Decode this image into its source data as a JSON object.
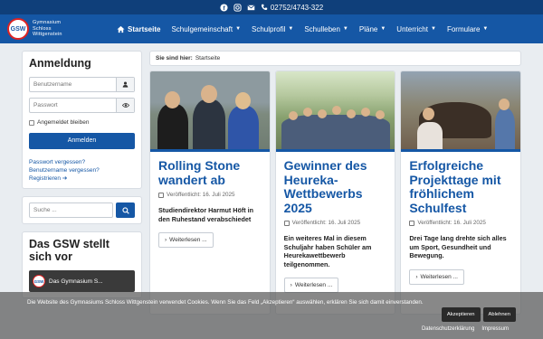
{
  "topbar": {
    "phone": "02752/4743-322",
    "icons": [
      "facebook-icon",
      "instagram-icon",
      "mail-icon",
      "phone-icon"
    ]
  },
  "logo": {
    "badge": "GSW",
    "line1": "Gymnasium",
    "line2": "Schloss",
    "line3": "Wittgenstein"
  },
  "nav": {
    "items": [
      {
        "label": "Startseite",
        "home": true
      },
      {
        "label": "Schulgemeinschaft"
      },
      {
        "label": "Schulprofil"
      },
      {
        "label": "Schulleben"
      },
      {
        "label": "Pläne"
      },
      {
        "label": "Unterricht"
      },
      {
        "label": "Formulare"
      }
    ]
  },
  "login": {
    "title": "Anmeldung",
    "username_placeholder": "Benutzername",
    "password_placeholder": "Passwort",
    "remember_label": "Angemeldet bleiben",
    "submit_label": "Anmelden",
    "forgot_password": "Passwort vergessen?",
    "forgot_username": "Benutzername vergessen?",
    "register": "Registrieren"
  },
  "search": {
    "placeholder": "Suche ..."
  },
  "about": {
    "title": "Das GSW stellt sich vor",
    "video_title": "Das Gymnasium S..."
  },
  "breadcrumb": {
    "label": "Sie sind hier:",
    "current": "Startseite"
  },
  "articles": [
    {
      "title": "Rolling Stone wandert ab",
      "published": "Veröffentlicht: 16. Juli 2025",
      "summary": "Studiendirektor Harmut Höft in den Ruhestand verabschiedet",
      "more": "Weiterlesen ..."
    },
    {
      "title": "Gewinner des Heureka-Wettbewerbs 2025",
      "published": "Veröffentlicht: 16. Juli 2025",
      "summary": "Ein weiteres Mal in diesem Schuljahr haben Schüler am Heurekawettbewerb teilgenommen.",
      "more": "Weiterlesen ..."
    },
    {
      "title": "Erfolgreiche Projekttage mit fröhlichem Schulfest",
      "published": "Veröffentlicht: 16. Juli 2025",
      "summary": "Drei Tage lang drehte sich alles um Sport, Gesundheit und Bewegung.",
      "more": "Weiterlesen ..."
    }
  ],
  "cookie": {
    "text": "Die Website des Gymnasiums Schloss Wittgenstein verwendet Cookies. Wenn Sie das Feld „Akzeptieren“ auswählen, erklären Sie sich damit einverstanden.",
    "accept": "Akzeptieren",
    "decline": "Ablehnen",
    "privacy": "Datenschutzerklärung",
    "imprint": "Impressum"
  },
  "colors": {
    "brand": "#1557a5",
    "topbar": "#0f3f7a"
  }
}
